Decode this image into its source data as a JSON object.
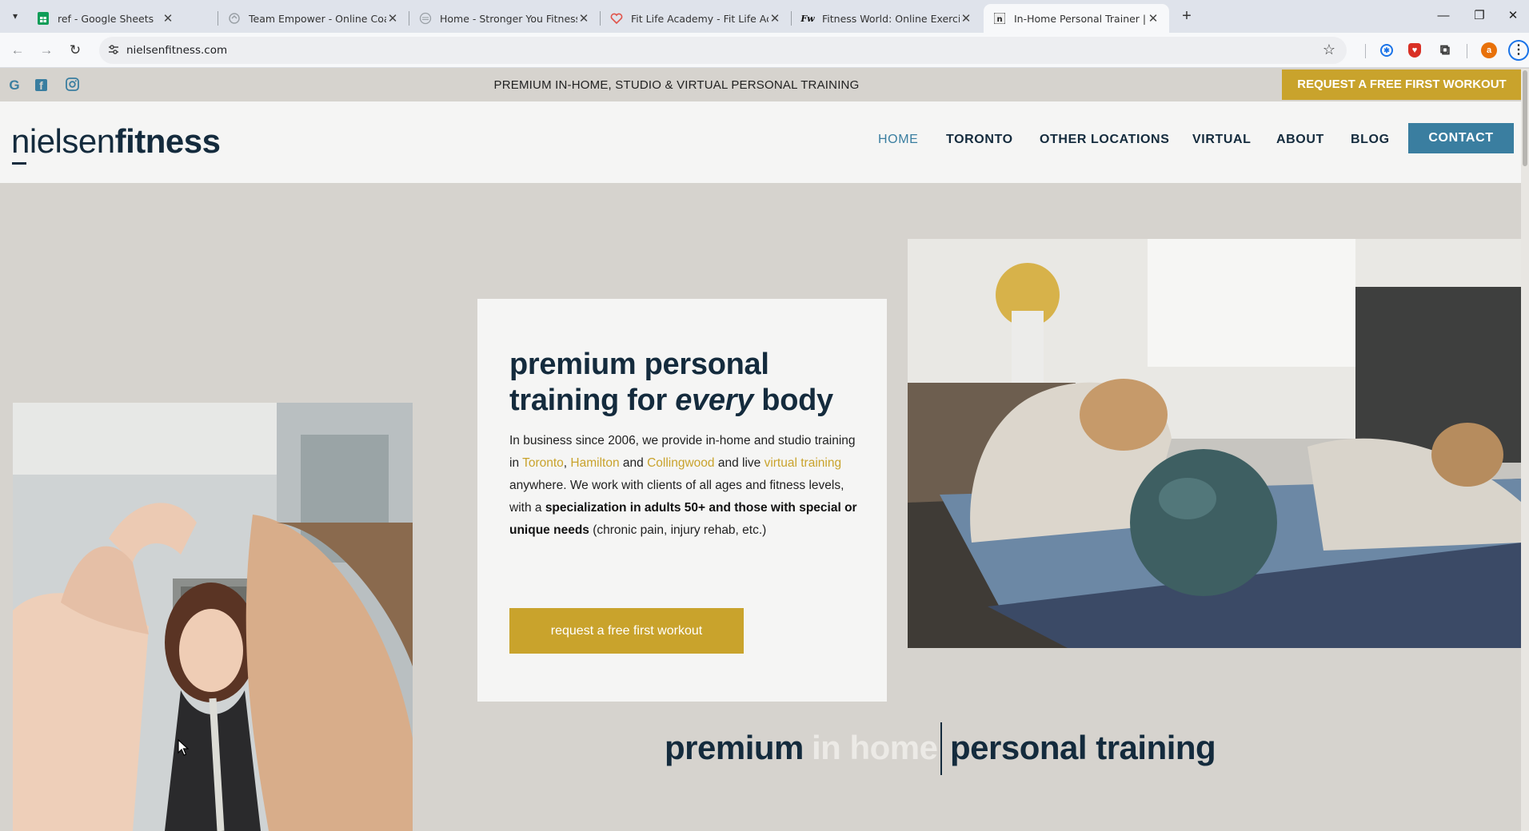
{
  "browser": {
    "tabs": [
      {
        "title": "ref - Google Sheets",
        "icon": "google-sheets-icon",
        "color": "#0f9d58",
        "active": false
      },
      {
        "title": "Team Empower - Online Coachi",
        "icon": "team-empower-icon",
        "color": "#9aa0a6",
        "active": false
      },
      {
        "title": "Home - Stronger You Fitness",
        "icon": "stronger-you-icon",
        "color": "#9aa0a6",
        "active": false
      },
      {
        "title": "Fit Life Academy - Fit Life Acad",
        "icon": "fit-life-heart-icon",
        "color": "#e0534a",
        "active": false
      },
      {
        "title": "Fitness World: Online Exercise C",
        "icon": "fitness-world-icon",
        "color": "#111111",
        "active": false
      },
      {
        "title": "In-Home Personal Trainer | Niel",
        "icon": "nielsen-n-icon",
        "color": "#333333",
        "active": true
      }
    ],
    "new_tab": "+",
    "url": "nielsenfitness.com",
    "profile_letter": "a"
  },
  "site": {
    "topbar": {
      "social": [
        {
          "name": "google-icon",
          "glyph": "G"
        },
        {
          "name": "facebook-icon",
          "glyph": "f"
        },
        {
          "name": "instagram-icon",
          "glyph": "◎"
        }
      ],
      "tagline": "PREMIUM IN-HOME, STUDIO & VIRTUAL PERSONAL TRAINING",
      "cta": "REQUEST A FREE FIRST WORKOUT"
    },
    "logo": {
      "part1": "nielsen",
      "part2": "fitness"
    },
    "nav": {
      "home": "HOME",
      "toronto": "TORONTO",
      "other_locations": "OTHER LOCATIONS",
      "virtual": "VIRTUAL",
      "about": "ABOUT",
      "blog": "BLOG",
      "contact": "CONTACT"
    },
    "hero": {
      "title_line1": "premium personal",
      "title_pre": "training for ",
      "title_em": "every",
      "title_post": " body",
      "body_1": "In business since 2006, we provide in-home and studio training in ",
      "link_toronto": "Toronto",
      "sep_1": ", ",
      "link_hamilton": "Hamilton",
      "and_1": " and ",
      "link_collingwood": "Collingwood",
      "and_live": " and live ",
      "link_virtual": "virtual training",
      "body_2": " anywhere. We work with clients of all ages and fitness levels, with a ",
      "body_bold": "specialization in adults 50+ and those with special or unique needs",
      "body_3": " (chronic pain, injury rehab, etc.)",
      "button": "request a free first workout"
    },
    "headline": {
      "word1": "premium",
      "word2": "in home",
      "word3": "personal training"
    },
    "colors": {
      "navy": "#142b3d",
      "teal": "#3a7ea0",
      "gold": "#c9a32c",
      "bg": "#d6d3ce"
    }
  }
}
